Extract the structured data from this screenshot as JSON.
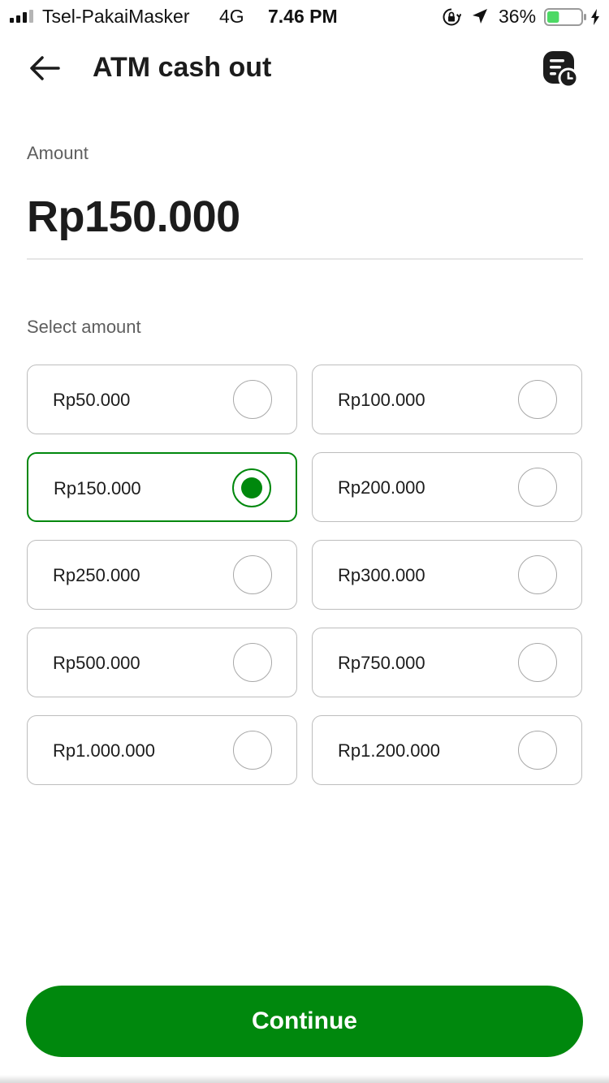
{
  "status_bar": {
    "carrier": "Tsel-PakaiMasker",
    "network": "4G",
    "time": "7.46 PM",
    "battery_percent": "36%",
    "battery_level": 0.36,
    "icons": [
      "signal-icon",
      "orientation-lock-icon",
      "location-icon",
      "battery-icon",
      "charging-bolt-icon"
    ]
  },
  "header": {
    "title": "ATM cash out",
    "back_icon": "arrow-left-icon",
    "history_icon": "transaction-history-icon"
  },
  "amount": {
    "label": "Amount",
    "value": "Rp150.000"
  },
  "select": {
    "label": "Select amount",
    "selected_index": 2,
    "options": [
      {
        "label": "Rp50.000",
        "selected": false
      },
      {
        "label": "Rp100.000",
        "selected": false
      },
      {
        "label": "Rp150.000",
        "selected": true
      },
      {
        "label": "Rp200.000",
        "selected": false
      },
      {
        "label": "Rp250.000",
        "selected": false
      },
      {
        "label": "Rp300.000",
        "selected": false
      },
      {
        "label": "Rp500.000",
        "selected": false
      },
      {
        "label": "Rp750.000",
        "selected": false
      },
      {
        "label": "Rp1.000.000",
        "selected": false
      },
      {
        "label": "Rp1.200.000",
        "selected": false
      }
    ]
  },
  "footer": {
    "continue_label": "Continue"
  },
  "colors": {
    "accent": "#00880d",
    "text": "#1c1c1c",
    "muted": "#5e5e5e",
    "border": "#bdbdbd",
    "battery_fill": "#4cd964"
  }
}
